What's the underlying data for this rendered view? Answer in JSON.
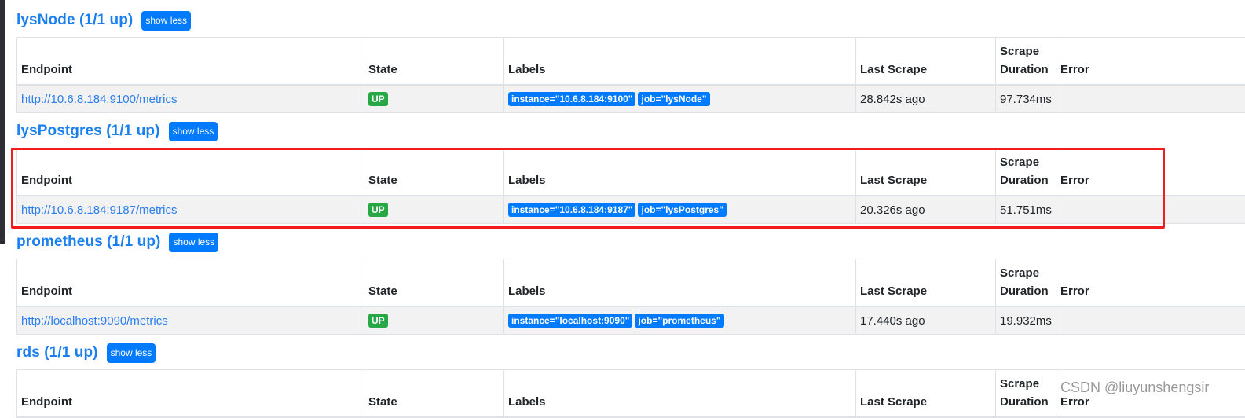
{
  "columns": [
    "Endpoint",
    "State",
    "Labels",
    "Last Scrape",
    "Scrape Duration",
    "Error"
  ],
  "colors": {
    "accent": "#007bff",
    "title": "#1a7ff0",
    "up_badge": "#28a745",
    "highlight": "#f21c1c",
    "row_bg": "#f2f2f2"
  },
  "jobs": [
    {
      "title": "lysNode (1/1 up)",
      "toggle_label": "show less",
      "targets": [
        {
          "endpoint": "http://10.6.8.184:9100/metrics",
          "state": "UP",
          "labels": [
            "instance=\"10.6.8.184:9100\"",
            "job=\"lysNode\""
          ],
          "last_scrape": "28.842s ago",
          "scrape_duration": "97.734ms",
          "error": ""
        }
      ]
    },
    {
      "title": "lysPostgres (1/1 up)",
      "toggle_label": "show less",
      "targets": [
        {
          "endpoint": "http://10.6.8.184:9187/metrics",
          "state": "UP",
          "labels": [
            "instance=\"10.6.8.184:9187\"",
            "job=\"lysPostgres\""
          ],
          "last_scrape": "20.326s ago",
          "scrape_duration": "51.751ms",
          "error": ""
        }
      ]
    },
    {
      "title": "prometheus (1/1 up)",
      "toggle_label": "show less",
      "targets": [
        {
          "endpoint": "http://localhost:9090/metrics",
          "state": "UP",
          "labels": [
            "instance=\"localhost:9090\"",
            "job=\"prometheus\""
          ],
          "last_scrape": "17.440s ago",
          "scrape_duration": "19.932ms",
          "error": ""
        }
      ]
    },
    {
      "title": "rds (1/1 up)",
      "toggle_label": "show less",
      "targets": []
    }
  ],
  "watermark": "CSDN @liuyunshengsir"
}
